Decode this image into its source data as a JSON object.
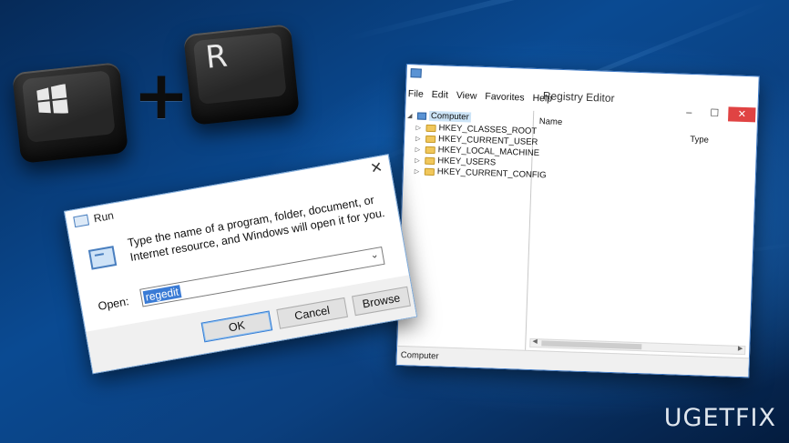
{
  "keys": {
    "win_key": "windows-logo",
    "plus": "+",
    "r_key": "R"
  },
  "run_dialog": {
    "title": "Run",
    "close": "✕",
    "description": "Type the name of a program, folder, document, or Internet resource, and Windows will open it for you.",
    "open_label": "Open:",
    "open_value": "regedit",
    "buttons": {
      "ok": "OK",
      "cancel": "Cancel",
      "browse": "Browse"
    }
  },
  "registry_editor": {
    "title": "Registry Editor",
    "controls": {
      "minimize": "–",
      "maximize": "☐",
      "close": "✕"
    },
    "menu": [
      "File",
      "Edit",
      "View",
      "Favorites",
      "Help"
    ],
    "tree_root": "Computer",
    "tree_items": [
      "HKEY_CLASSES_ROOT",
      "HKEY_CURRENT_USER",
      "HKEY_LOCAL_MACHINE",
      "HKEY_USERS",
      "HKEY_CURRENT_CONFIG"
    ],
    "columns": {
      "name": "Name",
      "type": "Type"
    },
    "status": "Computer"
  },
  "watermark": {
    "left": "UG",
    "mid": "E",
    "right": "TFIX"
  },
  "colors": {
    "accent_blue": "#2f7bd6",
    "close_red": "#e04343",
    "folder_yellow": "#f1c75b"
  }
}
